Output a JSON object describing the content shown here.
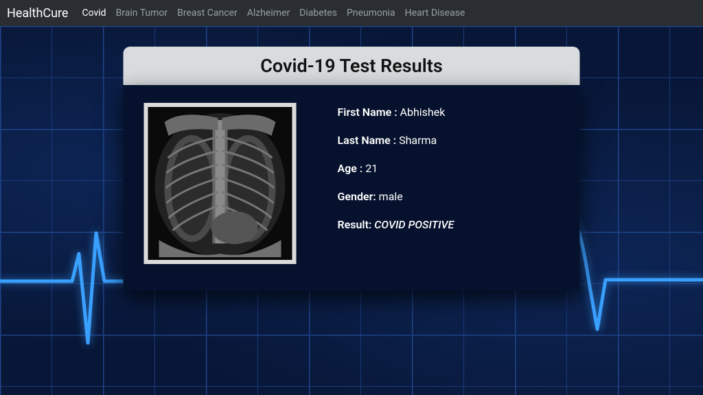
{
  "navbar": {
    "brand": "HealthCure",
    "items": [
      {
        "label": "Covid",
        "active": true
      },
      {
        "label": "Brain Tumor",
        "active": false
      },
      {
        "label": "Breast Cancer",
        "active": false
      },
      {
        "label": "Alzheimer",
        "active": false
      },
      {
        "label": "Diabetes",
        "active": false
      },
      {
        "label": "Pneumonia",
        "active": false
      },
      {
        "label": "Heart Disease",
        "active": false
      }
    ]
  },
  "card": {
    "title": "Covid-19 Test Results",
    "labels": {
      "first_name": "First Name : ",
      "last_name": "Last Name : ",
      "age": "Age : ",
      "gender": "Gender: ",
      "result": "Result: "
    },
    "patient": {
      "first_name": "Abhishek",
      "last_name": "Sharma",
      "age": "21",
      "gender": "male",
      "result": "COVID POSITIVE"
    }
  }
}
